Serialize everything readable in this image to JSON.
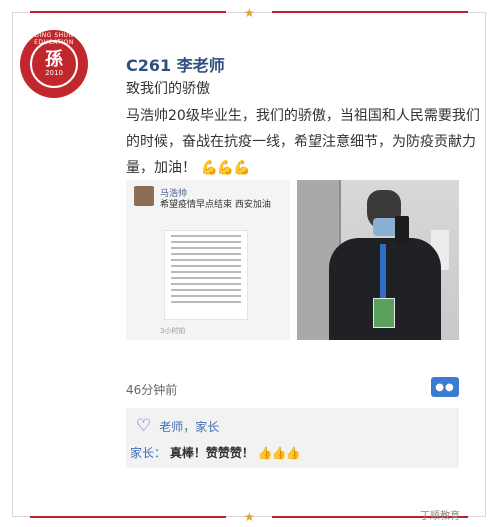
{
  "logo": {
    "emblem": "孫",
    "year": "2010",
    "ring_text": "DING SHUN EDUCATION"
  },
  "post": {
    "teacher_name": "C261 李老师",
    "title": "致我们的骄傲",
    "body": "马浩帅20级毕业生，我们的骄傲，当祖国和人民需要我们的时候，奋战在抗疫一线，希望注意细节，为防疫贡献力量，加油！",
    "body_emojis": "💪💪💪",
    "timestamp": "46分钟前"
  },
  "chat_image": {
    "name": "马浩帅",
    "message": "希望疫情早点结束 西安加油",
    "time": "3小时前"
  },
  "comments": {
    "likes": "老师，家长",
    "items": [
      {
        "user": "家长：",
        "text": "真棒！赞赞赞！",
        "emojis": "👍👍👍"
      }
    ]
  },
  "icons": {
    "like": "heart-icon",
    "comment": "comment-icon",
    "star": "star-icon"
  },
  "colors": {
    "brand_red": "#c2272d",
    "accent_blue": "#3c7bd1",
    "name_blue": "#2f4f7f"
  },
  "watermark": "丁顺教育"
}
